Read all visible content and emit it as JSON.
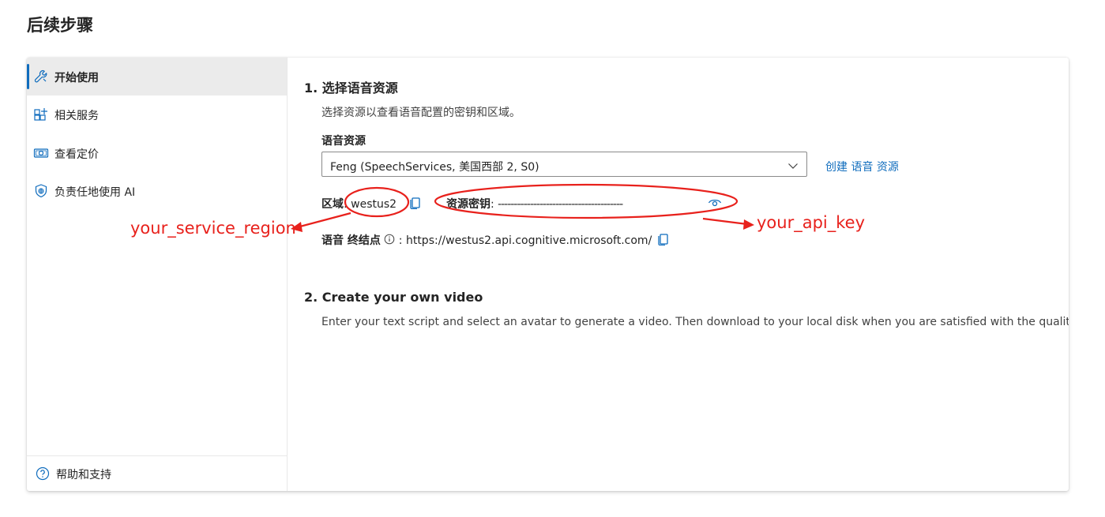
{
  "page": {
    "title": "后续步骤"
  },
  "sidebar": {
    "items": [
      {
        "label": "开始使用",
        "icon": "wrench-icon",
        "active": true
      },
      {
        "label": "相关服务",
        "icon": "apps-add-icon"
      },
      {
        "label": "查看定价",
        "icon": "money-icon"
      },
      {
        "label": "负责任地使用 AI",
        "icon": "shield-globe-icon"
      }
    ],
    "footer": {
      "label": "帮助和支持",
      "icon": "question-circle-icon"
    }
  },
  "step1": {
    "title": "1. 选择语音资源",
    "description": "选择资源以查看语音配置的密钥和区域。",
    "resource_label": "语音资源",
    "resource_value": "Feng (SpeechServices, 美国西部 2, S0)",
    "create_link": "创建 语音 资源",
    "region_label": "区域",
    "region_value": "westus2",
    "key_label": "资源密钥",
    "key_value": "---------------------------------------",
    "endpoint_label": "语音 终结点",
    "endpoint_value": "https://westus2.api.cognitive.microsoft.com/"
  },
  "step2": {
    "title": "2. Create your own video",
    "description": "Enter your text script and select an avatar to generate a video. Then download to your local disk when you are satisfied with the quality."
  },
  "annotations": {
    "region_note": "your_service_region",
    "key_note": "your_api_key",
    "color": "#e8211c"
  },
  "colors": {
    "accent": "#0f6cbd",
    "active_bg": "#ebebeb"
  }
}
